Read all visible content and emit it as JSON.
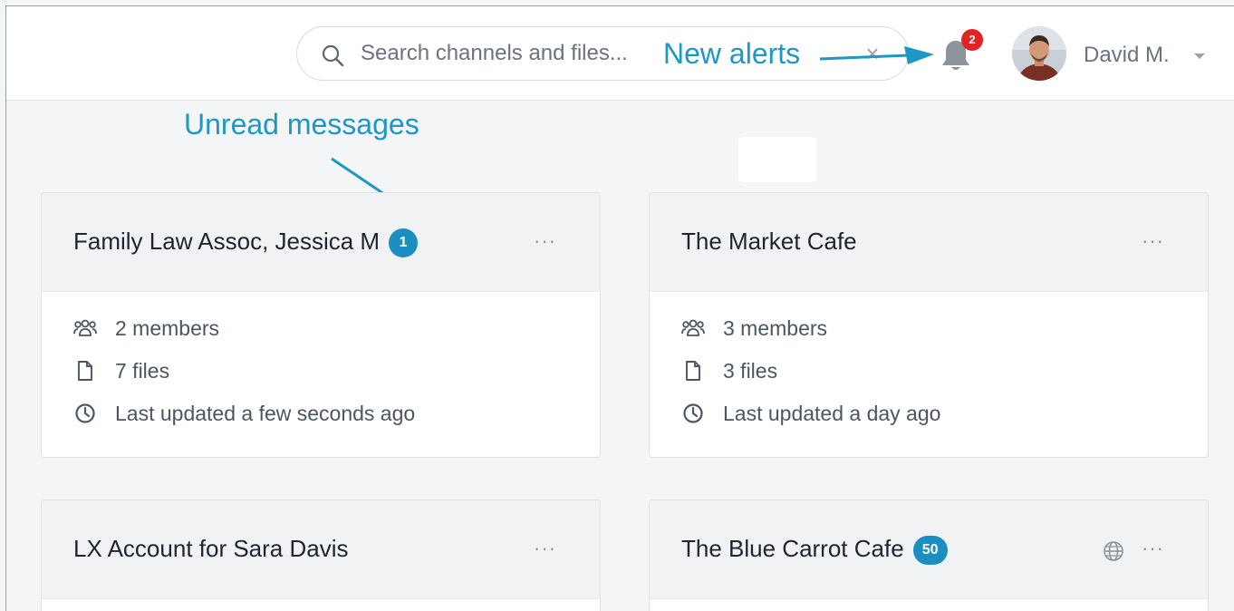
{
  "header": {
    "search": {
      "placeholder": "Search channels and files...",
      "value": "",
      "clear_label": "×"
    },
    "notifications": {
      "count": "2"
    },
    "user": {
      "name": "David M."
    }
  },
  "annotations": {
    "new_alerts": "New alerts",
    "unread_messages": "Unread messages"
  },
  "channels": [
    {
      "title": "Family Law Assoc, Jessica M",
      "unread": "1",
      "members": "2 members",
      "files": "7 files",
      "updated": "Last updated a few seconds ago",
      "more": "···"
    },
    {
      "title": "The Market Cafe",
      "unread": "",
      "members": "3 members",
      "files": "3 files",
      "updated": "Last updated a day ago",
      "more": "···"
    },
    {
      "title": "LX Account for Sara Davis",
      "unread": "",
      "more": "···"
    },
    {
      "title": "The Blue Carrot Cafe",
      "unread": "50",
      "public": true,
      "more": "···"
    }
  ],
  "colors": {
    "accent": "#1b8fc0",
    "annotation": "#1b98c4",
    "alert_badge": "#e02424",
    "card_header": "#f1f2f4",
    "page_bg": "#f4f5f7"
  },
  "icons": {
    "search": "search-icon",
    "bell": "bell-icon",
    "members": "members-icon",
    "files": "file-icon",
    "updated": "clock-icon",
    "public": "globe-icon",
    "more": "more-icon"
  }
}
